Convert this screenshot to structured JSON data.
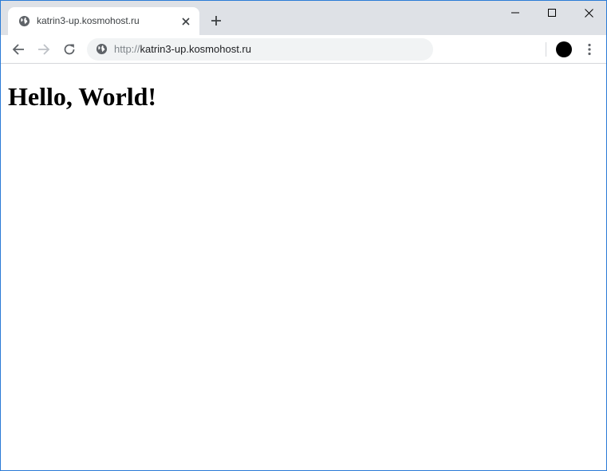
{
  "tab": {
    "title": "katrin3-up.kosmohost.ru",
    "favicon": "globe-icon",
    "close": "close-icon"
  },
  "new_tab": {
    "icon": "plus-icon"
  },
  "window_controls": {
    "minimize": "minimize-icon",
    "maximize": "maximize-icon",
    "close": "close-icon"
  },
  "toolbar": {
    "back": "arrow-left-icon",
    "forward": "arrow-right-icon",
    "reload": "reload-icon",
    "menu": "kebab-menu-icon",
    "profile": "avatar"
  },
  "omnibox": {
    "security_icon": "globe-icon",
    "url_scheme": "http://",
    "url_host": "katrin3-up.kosmohost.ru"
  },
  "page": {
    "heading": "Hello, World!"
  },
  "colors": {
    "tabstrip": "#dee1e6",
    "omnibox": "#f1f3f4",
    "window_border": "#2b7bd6",
    "forward_disabled": "#bdc1c6"
  }
}
